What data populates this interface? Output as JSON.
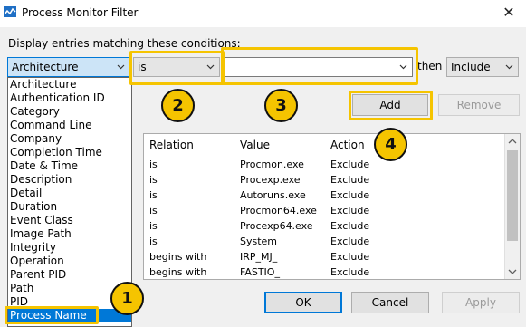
{
  "window": {
    "title": "Process Monitor Filter",
    "close_glyph": "✕"
  },
  "form": {
    "conditions_label": "Display entries matching these conditions:",
    "column_value": "Architecture",
    "relation_value": "is",
    "value_text": "",
    "then_label": "then",
    "action_value": "Include"
  },
  "buttons": {
    "add": "Add",
    "remove": "Remove",
    "ok": "OK",
    "cancel": "Cancel",
    "apply": "Apply"
  },
  "table": {
    "headers": [
      "Relation",
      "Value",
      "Action"
    ],
    "rows": [
      [
        "is",
        "Procmon.exe",
        "Exclude"
      ],
      [
        "is",
        "Procexp.exe",
        "Exclude"
      ],
      [
        "is",
        "Autoruns.exe",
        "Exclude"
      ],
      [
        "is",
        "Procmon64.exe",
        "Exclude"
      ],
      [
        "is",
        "Procexp64.exe",
        "Exclude"
      ],
      [
        "is",
        "System",
        "Exclude"
      ],
      [
        "begins with",
        "IRP_MJ_",
        "Exclude"
      ],
      [
        "begins with",
        "FASTIO_",
        "Exclude"
      ]
    ]
  },
  "dropdown": {
    "items": [
      "Architecture",
      "Authentication ID",
      "Category",
      "Command Line",
      "Company",
      "Completion Time",
      "Date & Time",
      "Description",
      "Detail",
      "Duration",
      "Event Class",
      "Image Path",
      "Integrity",
      "Operation",
      "Parent PID",
      "Path",
      "PID",
      "Process Name"
    ],
    "selected": "Process Name"
  },
  "callouts": [
    "1",
    "2",
    "3",
    "4"
  ],
  "colors": {
    "callout": "#f5c400",
    "selection": "#0078d7"
  }
}
